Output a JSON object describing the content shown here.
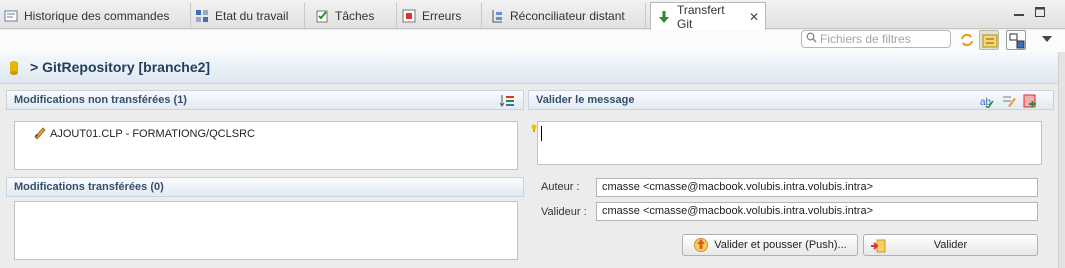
{
  "tabs": [
    {
      "label": "Historique des commandes",
      "icon": "history-icon"
    },
    {
      "label": "Etat du travail",
      "icon": "job-status-icon"
    },
    {
      "label": "Tâches",
      "icon": "tasks-icon"
    },
    {
      "label": "Erreurs",
      "icon": "errors-icon"
    },
    {
      "label": "Réconciliateur distant",
      "icon": "reconciler-icon"
    },
    {
      "label": "Transfert Git",
      "icon": "git-transfer-icon",
      "active": true
    }
  ],
  "toolbar": {
    "filter_placeholder": "Fichiers de filtres"
  },
  "repository": {
    "title": "> GitRepository [branche2]"
  },
  "unstaged": {
    "title": "Modifications non transférées (1)",
    "items": [
      "AJOUT01.CLP - FORMATIONG/QCLSRC"
    ]
  },
  "staged": {
    "title": "Modifications transférées (0)",
    "items": []
  },
  "commit": {
    "title": "Valider le message",
    "message": "",
    "author_label": "Auteur :",
    "author_value": "cmasse <cmasse@macbook.volubis.intra.volubis.intra>",
    "committer_label": "Valideur :",
    "committer_value": "cmasse <cmasse@macbook.volubis.intra.volubis.intra>",
    "commit_push_label": "Valider et pousser (Push)...",
    "commit_label": "Valider"
  },
  "colors": {
    "accent": "#233f5c",
    "section_text": "#34506d",
    "git_green": "#2e8b2e"
  }
}
